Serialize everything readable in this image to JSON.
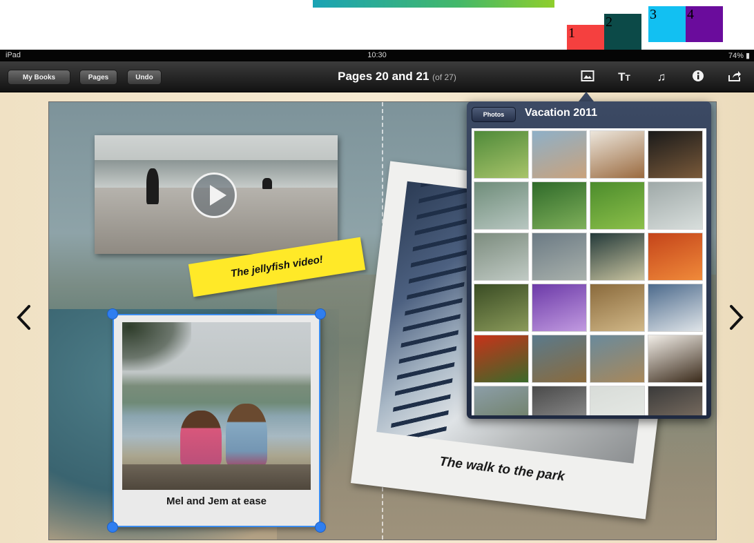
{
  "status_bar": {
    "device": "iPad",
    "time": "10:30",
    "battery": "74%"
  },
  "nav": {
    "my_books": "My Books",
    "pages": "Pages",
    "undo": "Undo",
    "title": "Pages 20 and 21",
    "subtitle": "(of 27)"
  },
  "toolbar_icons": {
    "photo": "image-icon",
    "text": "text-size-icon",
    "music": "music-note-icon",
    "info": "info-icon",
    "share": "share-icon"
  },
  "markers": [
    "1",
    "2",
    "3",
    "4"
  ],
  "marker_colors": [
    "#f5403f",
    "#0c4a48",
    "#12c0f2",
    "#6a0c9c"
  ],
  "page": {
    "video_note": "The jellyfish video!",
    "photo_caption": "Mel and Jem at ease",
    "bridge_caption": "The walk to the park"
  },
  "popover": {
    "back_button": "Photos",
    "title": "Vacation 2011",
    "thumbnails": [
      {
        "name": "thumb-family-lawn",
        "colors": [
          "#4f8a3a",
          "#a8c46a"
        ]
      },
      {
        "name": "thumb-child-beach",
        "colors": [
          "#8eb0c8",
          "#c9a27c"
        ]
      },
      {
        "name": "thumb-plate-food",
        "colors": [
          "#ece6dc",
          "#9a6a3f"
        ]
      },
      {
        "name": "thumb-night-people",
        "colors": [
          "#1a1a1a",
          "#7a5a3a"
        ]
      },
      {
        "name": "thumb-river-park",
        "colors": [
          "#6f8d7a",
          "#b7c6c0"
        ]
      },
      {
        "name": "thumb-green-hills",
        "colors": [
          "#2f6a2a",
          "#7fb05a"
        ]
      },
      {
        "name": "thumb-girl-grass",
        "colors": [
          "#4c8c2c",
          "#8cc04a"
        ]
      },
      {
        "name": "thumb-buildings",
        "colors": [
          "#9fa9a8",
          "#d8dedc"
        ]
      },
      {
        "name": "thumb-agave-plants",
        "colors": [
          "#7c8c7e",
          "#c0cac4"
        ]
      },
      {
        "name": "thumb-coast-view",
        "colors": [
          "#6b7a84",
          "#a9b1ac"
        ]
      },
      {
        "name": "thumb-palm-sunset",
        "colors": [
          "#243a3a",
          "#c9c4a0"
        ]
      },
      {
        "name": "thumb-orange-sky",
        "colors": [
          "#c4441a",
          "#f08a3a"
        ]
      },
      {
        "name": "thumb-forest-path",
        "colors": [
          "#3a4c24",
          "#8a9a5a"
        ]
      },
      {
        "name": "thumb-purple-flower",
        "colors": [
          "#6c3aa8",
          "#c19ae0"
        ]
      },
      {
        "name": "thumb-stone-arch",
        "colors": [
          "#8a6a3c",
          "#d1b888"
        ]
      },
      {
        "name": "thumb-steel-bridge",
        "colors": [
          "#4c6a8c",
          "#dfe4e8"
        ]
      },
      {
        "name": "thumb-red-flowers",
        "colors": [
          "#c8321a",
          "#3a6a2a"
        ]
      },
      {
        "name": "thumb-duck-water",
        "colors": [
          "#5a7a8c",
          "#8a6a3c"
        ]
      },
      {
        "name": "thumb-duck-close",
        "colors": [
          "#6a8a9c",
          "#a8885a"
        ]
      },
      {
        "name": "thumb-white-dog",
        "colors": [
          "#f2eee8",
          "#3a2a1a"
        ]
      },
      {
        "name": "thumb-hill-town",
        "colors": [
          "#8c9ea8",
          "#6a7a5a"
        ]
      },
      {
        "name": "thumb-city-street",
        "colors": [
          "#4a4a4a",
          "#9a9a9a"
        ]
      },
      {
        "name": "thumb-pale-sky",
        "colors": [
          "#d8dcd8",
          "#e9ece8"
        ]
      },
      {
        "name": "thumb-rail-tracks",
        "colors": [
          "#3a3a3a",
          "#8a7a6a"
        ]
      }
    ]
  }
}
